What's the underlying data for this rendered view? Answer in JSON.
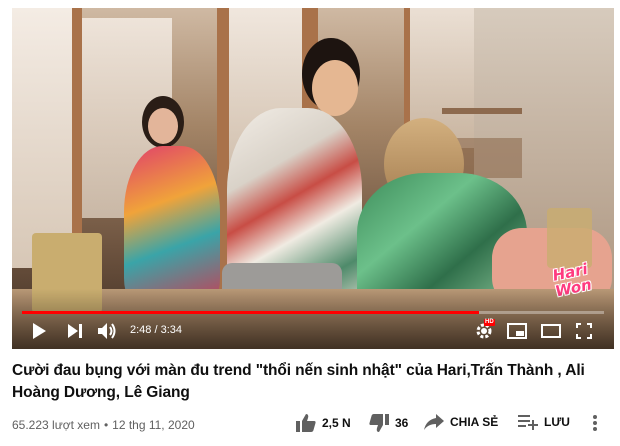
{
  "video": {
    "current_time": "2:48",
    "duration": "3:34",
    "progress_fraction": 0.785,
    "hd_badge": "HD",
    "watermark": "Hari\nWon"
  },
  "info": {
    "title": "Cười đau bụng với màn đu trend \"thổi nến sinh nhật\" của Hari,Trấn Thành , Ali Hoàng Dương, Lê Giang",
    "views": "65.223 lượt xem",
    "separator": "•",
    "date": "12 thg 11, 2020"
  },
  "actions": {
    "like_count": "2,5 N",
    "dislike_count": "36",
    "share_label": "CHIA SẺ",
    "save_label": "LƯU"
  },
  "icons": {
    "play": "play-icon",
    "next": "next-icon",
    "volume": "volume-icon",
    "settings": "settings-icon",
    "miniplayer": "miniplayer-icon",
    "theater": "theater-icon",
    "fullscreen": "fullscreen-icon",
    "like": "thumbs-up-icon",
    "dislike": "thumbs-down-icon",
    "share": "share-icon",
    "save": "playlist-add-icon",
    "more": "more-icon"
  },
  "colors": {
    "progress": "#ff0000",
    "text_primary": "#0f0f0f",
    "text_secondary": "#606060"
  }
}
